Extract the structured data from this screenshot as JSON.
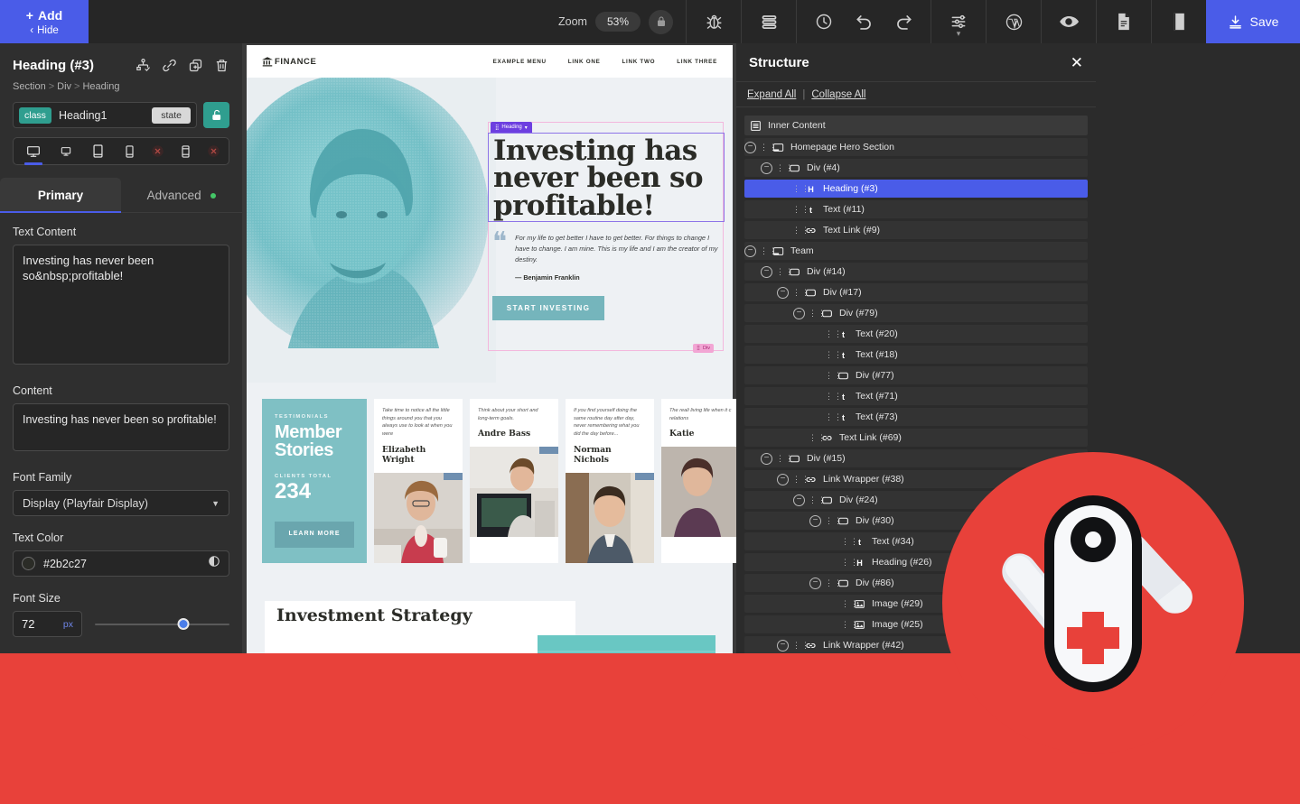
{
  "toolbar": {
    "add_label": "Add",
    "hide_label": "Hide",
    "zoom_label": "Zoom",
    "zoom_value": "53%",
    "save_label": "Save",
    "icons": [
      "lock-icon",
      "bug-icon",
      "layers-icon",
      "history-clock-icon",
      "undo-icon",
      "redo-icon",
      "settings-sliders-icon",
      "wordpress-icon",
      "preview-eye-icon",
      "page-icon",
      "library-icon",
      "save-download-icon"
    ]
  },
  "left_panel": {
    "title": "Heading (#3)",
    "breadcrumb": [
      "Section",
      "Div",
      "Heading"
    ],
    "class_tag": "class",
    "class_value": "Heading1",
    "state_label": "state",
    "devices": [
      "desktop",
      "laptop",
      "tablet",
      "mobile-landscape",
      "mobile-portrait"
    ],
    "tabs": [
      {
        "label": "Primary",
        "active": true
      },
      {
        "label": "Advanced",
        "active": false
      }
    ],
    "fields": {
      "text_content_label": "Text Content",
      "text_content_value": "Investing has never been so&nbsp;profitable!",
      "content_label": "Content",
      "content_value": "Investing has never been so profitable!",
      "font_family_label": "Font Family",
      "font_family_value": "Display (Playfair Display)",
      "text_color_label": "Text Color",
      "text_color_value": "#2b2c27",
      "font_size_label": "Font Size",
      "font_size_value": "72",
      "font_size_unit": "px"
    }
  },
  "canvas": {
    "site": {
      "logo": "FINANCE",
      "nav_links": [
        "EXAMPLE MENU",
        "LINK ONE",
        "LINK TWO",
        "LINK THREE"
      ],
      "heading_badge": "Heading",
      "div_badge": "Div",
      "hero_heading": "Investing has never been so profitable!",
      "hero_quote": "For my life to get better I have to get better. For things to change I have to change. I am mine. This is my life and I am the creator of my destiny.",
      "hero_attribution": "— Benjamin Franklin",
      "hero_cta": "START INVESTING",
      "testimonials": {
        "kicker": "TESTIMONIALS",
        "title": "Member Stories",
        "total_label": "CLIENTS TOTAL",
        "total_value": "234",
        "button": "LEARN MORE",
        "cards": [
          {
            "quote": "Take time to notice all the little things around you that you always use to look at when you were",
            "name": "Elizabeth Wright"
          },
          {
            "quote": "Think about your short and long-term goals.",
            "name": "Andre Bass"
          },
          {
            "quote": "If you find yourself doing the same routine day after day, never remembering what you did the day before...",
            "name": "Norman Nichols"
          },
          {
            "quote": "The reali living life when it c relations",
            "name": "Katie"
          }
        ]
      },
      "strategy_heading": "Investment Strategy"
    }
  },
  "structure": {
    "title": "Structure",
    "expand_all": "Expand All",
    "collapse_all": "Collapse All",
    "root_label": "Inner Content",
    "nodes": [
      {
        "label": "Homepage Hero Section",
        "icon": "section-icon",
        "depth": 0,
        "collapse": true
      },
      {
        "label": "Div (#4)",
        "icon": "div-icon",
        "depth": 1,
        "collapse": true
      },
      {
        "label": "Heading (#3)",
        "icon": "heading-icon",
        "depth": 2,
        "collapse": false,
        "selected": true
      },
      {
        "label": "Text (#11)",
        "icon": "text-icon",
        "depth": 2,
        "collapse": false
      },
      {
        "label": "Text Link (#9)",
        "icon": "link-icon",
        "depth": 2,
        "collapse": false
      },
      {
        "label": "Team",
        "icon": "section-icon",
        "depth": 0,
        "collapse": true
      },
      {
        "label": "Div (#14)",
        "icon": "div-icon",
        "depth": 1,
        "collapse": true
      },
      {
        "label": "Div (#17)",
        "icon": "div-icon",
        "depth": 2,
        "collapse": true
      },
      {
        "label": "Div (#79)",
        "icon": "div-icon",
        "depth": 3,
        "collapse": true
      },
      {
        "label": "Text (#20)",
        "icon": "text-icon",
        "depth": 4,
        "collapse": false
      },
      {
        "label": "Text (#18)",
        "icon": "text-icon",
        "depth": 4,
        "collapse": false
      },
      {
        "label": "Div (#77)",
        "icon": "div-icon",
        "depth": 4,
        "collapse": false
      },
      {
        "label": "Text (#71)",
        "icon": "text-icon",
        "depth": 4,
        "collapse": false
      },
      {
        "label": "Text (#73)",
        "icon": "text-icon",
        "depth": 4,
        "collapse": false
      },
      {
        "label": "Text Link (#69)",
        "icon": "link-icon",
        "depth": 3,
        "collapse": false
      },
      {
        "label": "Div (#15)",
        "icon": "div-icon",
        "depth": 1,
        "collapse": true
      },
      {
        "label": "Link Wrapper (#38)",
        "icon": "link-icon",
        "depth": 2,
        "collapse": true
      },
      {
        "label": "Div (#24)",
        "icon": "div-icon",
        "depth": 3,
        "collapse": true
      },
      {
        "label": "Div (#30)",
        "icon": "div-icon",
        "depth": 4,
        "collapse": true
      },
      {
        "label": "Text (#34)",
        "icon": "text-icon",
        "depth": 5,
        "collapse": false
      },
      {
        "label": "Heading (#26)",
        "icon": "heading-icon",
        "depth": 5,
        "collapse": false
      },
      {
        "label": "Div (#86)",
        "icon": "div-icon",
        "depth": 4,
        "collapse": true
      },
      {
        "label": "Image (#29)",
        "icon": "image-icon",
        "depth": 5,
        "collapse": false
      },
      {
        "label": "Image (#25)",
        "icon": "image-icon",
        "depth": 5,
        "collapse": false
      },
      {
        "label": "Link Wrapper (#42)",
        "icon": "link-icon",
        "depth": 2,
        "collapse": true
      }
    ]
  },
  "overlay": {
    "knife_icon": "swiss-army-knife-icon",
    "accent_red": "#e8413a",
    "accent_blue": "#4a5ce8",
    "accent_teal": "#2f9e8f"
  }
}
